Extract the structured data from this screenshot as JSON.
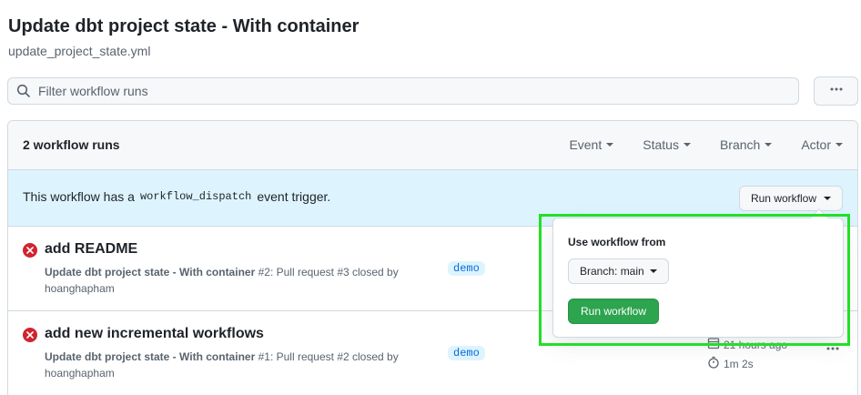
{
  "page": {
    "title": "Update dbt project state - With container",
    "subtitle": "update_project_state.yml"
  },
  "filter": {
    "placeholder": "Filter workflow runs"
  },
  "header": {
    "runs_count": "2 workflow runs",
    "filters": {
      "event": "Event",
      "status": "Status",
      "branch": "Branch",
      "actor": "Actor"
    }
  },
  "dispatch": {
    "text_before": "This workflow has a",
    "code": "workflow_dispatch",
    "text_after": "event trigger.",
    "button_label": "Run workflow"
  },
  "runs": [
    {
      "title": "add README",
      "workflow": "Update dbt project state - With container",
      "detail": "#2: Pull request #3 closed by",
      "actor": "hoanghapham",
      "branch": "demo",
      "when": "",
      "duration": "",
      "status": "failure"
    },
    {
      "title": "add new incremental workflows",
      "workflow": "Update dbt project state - With container",
      "detail": "#1: Pull request #2 closed by",
      "actor": "hoanghapham",
      "branch": "demo",
      "when": "21 hours ago",
      "duration": "1m 2s",
      "status": "failure"
    }
  ],
  "popover": {
    "label": "Use workflow from",
    "branch_select": "Branch: main",
    "submit_label": "Run workflow"
  },
  "colors": {
    "accent_green": "#2da44e",
    "failure_red": "#d1242f",
    "info_blue_bg": "#ddf4ff",
    "highlight": "#22e025"
  }
}
